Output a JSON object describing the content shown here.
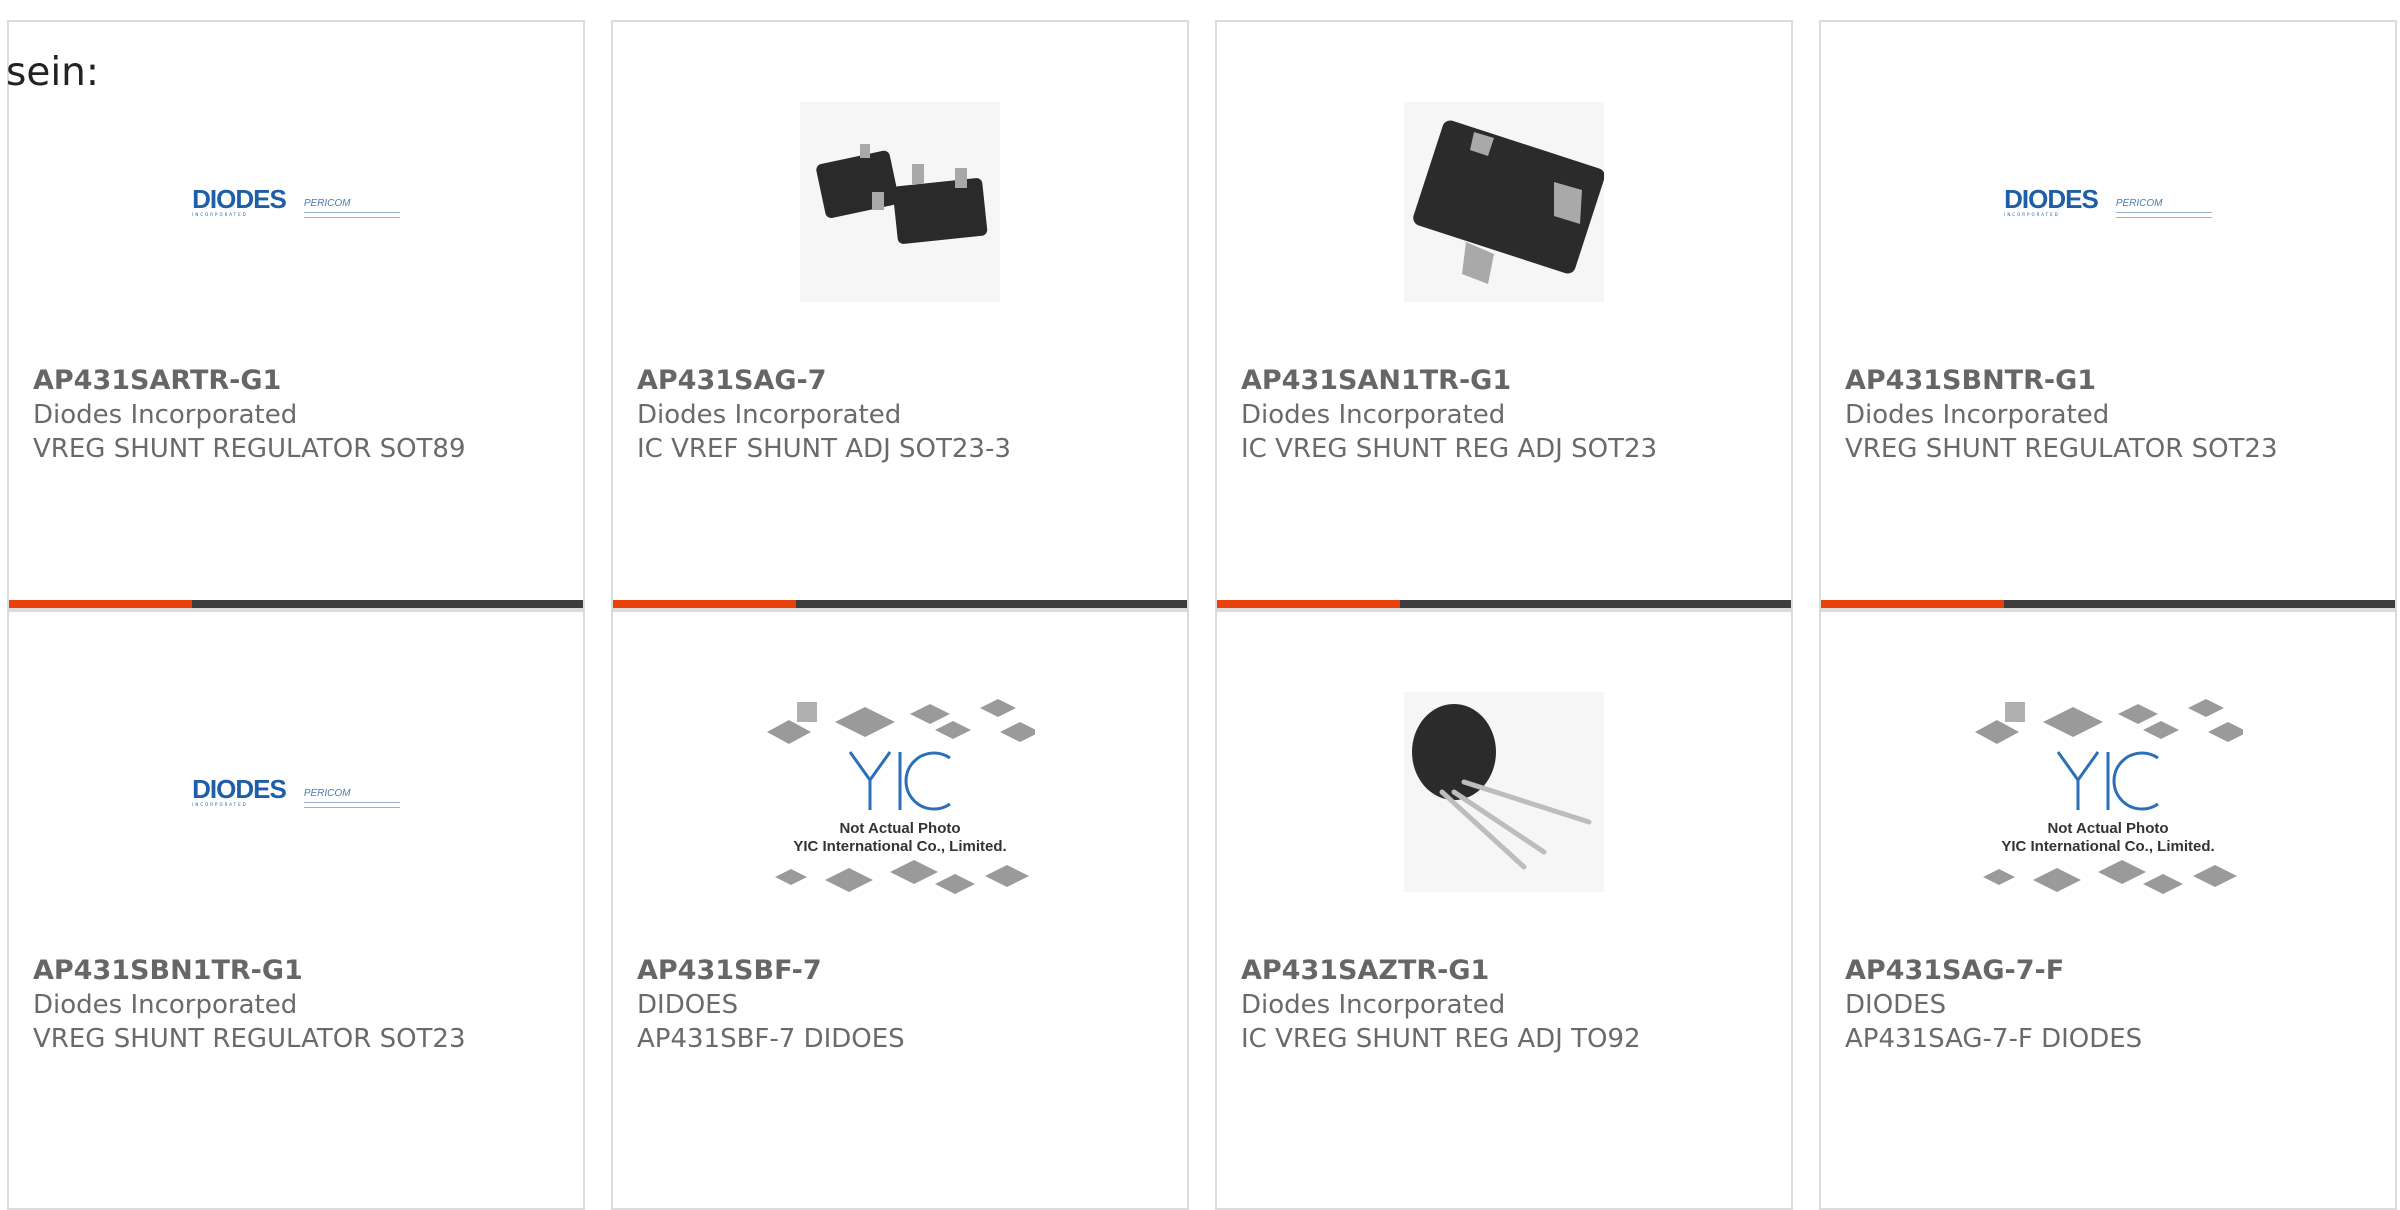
{
  "lead_text": "sein:",
  "colors": {
    "accent": "#e8410c",
    "bar": "#3d3d3d",
    "logo_blue": "#1f5fa8",
    "border": "#dcdcdc"
  },
  "products": [
    {
      "part_number": "AP431SARTR-G1",
      "manufacturer": "Diodes Incorporated",
      "description": "VREG SHUNT REGULATOR SOT89",
      "image": "diodes-pericom-logo"
    },
    {
      "part_number": "AP431SAG-7",
      "manufacturer": "Diodes Incorporated",
      "description": "IC VREF SHUNT ADJ SOT23-3",
      "image": "sot23-package-photo"
    },
    {
      "part_number": "AP431SAN1TR-G1",
      "manufacturer": "Diodes Incorporated",
      "description": "IC VREG SHUNT REG ADJ SOT23",
      "image": "sot23-package-photo"
    },
    {
      "part_number": "AP431SBNTR-G1",
      "manufacturer": "Diodes Incorporated",
      "description": "VREG SHUNT REGULATOR SOT23",
      "image": "diodes-pericom-logo"
    },
    {
      "part_number": "AP431SBN1TR-G1",
      "manufacturer": "Diodes Incorporated",
      "description": "VREG SHUNT REGULATOR SOT23",
      "image": "diodes-pericom-logo"
    },
    {
      "part_number": "AP431SBF-7",
      "manufacturer": "DIDOES",
      "description": "AP431SBF-7 DIDOES",
      "image": "yic-placeholder"
    },
    {
      "part_number": "AP431SAZTR-G1",
      "manufacturer": "Diodes Incorporated",
      "description": "IC VREG SHUNT REG ADJ TO92",
      "image": "to92-package-photo"
    },
    {
      "part_number": "AP431SAG-7-F",
      "manufacturer": "DIODES",
      "description": "AP431SAG-7-F DIODES",
      "image": "yic-placeholder"
    }
  ],
  "logo": {
    "brand": "DIODES",
    "brand_sub": "INCORPORATED",
    "partner": "PERICOM"
  },
  "placeholder": {
    "line1": "Not Actual Photo",
    "line2": "YIC International Co., Limited.",
    "mark": "YIC"
  }
}
